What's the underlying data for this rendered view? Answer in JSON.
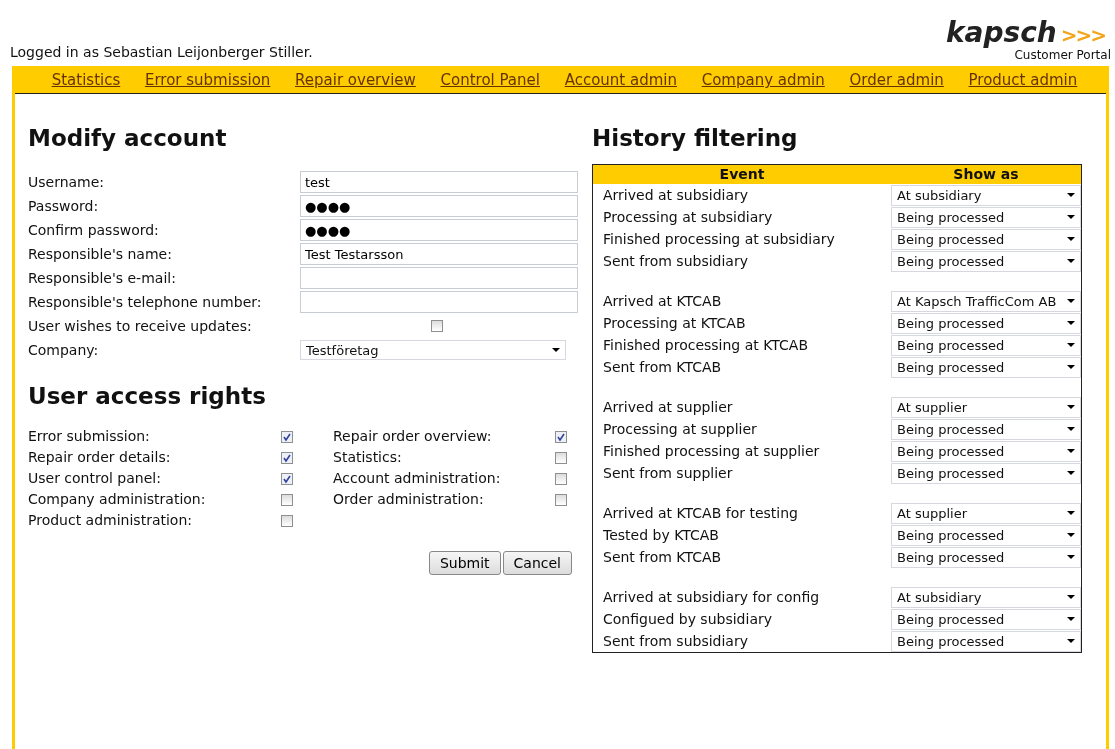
{
  "logo": {
    "name": "kapsch",
    "mark": ">>>",
    "subtitle": "Customer Portal"
  },
  "login_text": "Logged in as Sebastian Leijonberger Stiller.",
  "nav": [
    "Statistics",
    "Error submission",
    "Repair overview",
    "Control Panel",
    "Account admin",
    "Company admin",
    "Order admin",
    "Product admin"
  ],
  "modify_account": {
    "title": "Modify account",
    "fields": [
      {
        "label": "Username:",
        "kind": "text",
        "value": "test"
      },
      {
        "label": "Password:",
        "kind": "text",
        "value": "●●●●"
      },
      {
        "label": "Confirm password:",
        "kind": "text",
        "value": "●●●●"
      },
      {
        "label": "Responsible's name:",
        "kind": "text",
        "value": "Test Testarsson"
      },
      {
        "label": "Responsible's e-mail:",
        "kind": "text"
      },
      {
        "label": "Responsible's telephone number:",
        "kind": "text"
      },
      {
        "label": "User wishes to receive updates:",
        "kind": "checkbox",
        "checked": false
      },
      {
        "label": "Company:",
        "kind": "select",
        "value": "Testföretag"
      }
    ]
  },
  "access_rights": {
    "title": "User access rights",
    "items": [
      {
        "label": "Error submission:",
        "checked": true
      },
      {
        "label": "Repair order overview:",
        "checked": true
      },
      {
        "label": "Repair order details:",
        "checked": true
      },
      {
        "label": "Statistics:",
        "checked": false
      },
      {
        "label": "User control panel:",
        "checked": true
      },
      {
        "label": "Account administration:",
        "checked": false
      },
      {
        "label": "Company administration:",
        "checked": false
      },
      {
        "label": "Order administration:",
        "checked": false
      },
      {
        "label": "Product administration:",
        "checked": false
      }
    ]
  },
  "buttons": [
    "Submit",
    "Cancel"
  ],
  "history": {
    "title": "History filtering",
    "columns": [
      "Event",
      "Show as"
    ],
    "groups": [
      {
        "rows": [
          {
            "event": "Arrived at subsidiary",
            "show_as": "At subsidiary"
          },
          {
            "event": "Processing at subsidiary",
            "show_as": "Being processed"
          },
          {
            "event": "Finished processing at subsidiary",
            "show_as": "Being processed"
          },
          {
            "event": "Sent from subsidiary",
            "show_as": "Being processed"
          }
        ]
      },
      {
        "rows": [
          {
            "event": "Arrived at KTCAB",
            "show_as": "At Kapsch TrafficCom AB"
          },
          {
            "event": "Processing at KTCAB",
            "show_as": "Being processed"
          },
          {
            "event": "Finished processing at KTCAB",
            "show_as": "Being processed"
          },
          {
            "event": "Sent from KTCAB",
            "show_as": "Being processed"
          }
        ]
      },
      {
        "rows": [
          {
            "event": "Arrived at supplier",
            "show_as": "At supplier"
          },
          {
            "event": "Processing at supplier",
            "show_as": "Being processed"
          },
          {
            "event": "Finished processing at supplier",
            "show_as": "Being processed"
          },
          {
            "event": "Sent from supplier",
            "show_as": "Being processed"
          }
        ]
      },
      {
        "rows": [
          {
            "event": "Arrived at KTCAB for testing",
            "show_as": "At supplier"
          },
          {
            "event": "Tested by KTCAB",
            "show_as": "Being processed"
          },
          {
            "event": "Sent from KTCAB",
            "show_as": "Being processed"
          }
        ]
      },
      {
        "rows": [
          {
            "event": "Arrived at subsidiary for config",
            "show_as": "At subsidiary"
          },
          {
            "event": "Configued by subsidiary",
            "show_as": "Being processed"
          },
          {
            "event": "Sent from subsidiary",
            "show_as": "Being processed"
          }
        ]
      }
    ]
  }
}
